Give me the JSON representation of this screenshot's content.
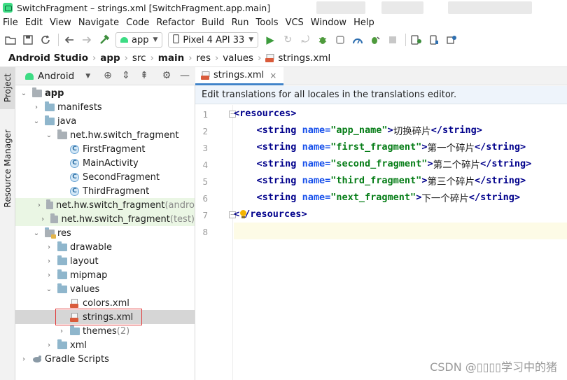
{
  "window": {
    "title": "SwitchFragment – strings.xml [SwitchFragment.app.main]"
  },
  "menu": [
    "File",
    "Edit",
    "View",
    "Navigate",
    "Code",
    "Refactor",
    "Build",
    "Run",
    "Tools",
    "VCS",
    "Window",
    "Help"
  ],
  "toolbar": {
    "module": "app",
    "device": "Pixel 4 API 33"
  },
  "breadcrumb": [
    "Android Studio",
    "app",
    "src",
    "main",
    "res",
    "values",
    "strings.xml"
  ],
  "side_tabs": {
    "project": "Project",
    "resource_manager": "Resource Manager"
  },
  "project_panel": {
    "view": "Android",
    "tree": [
      {
        "label": "app",
        "suffix": "",
        "depth": 0,
        "arrow": "▾",
        "icon": "folder-module",
        "bold": true
      },
      {
        "label": "manifests",
        "suffix": "",
        "depth": 1,
        "arrow": "›",
        "icon": "folder"
      },
      {
        "label": "java",
        "suffix": "",
        "depth": 1,
        "arrow": "▾",
        "icon": "folder"
      },
      {
        "label": "net.hw.switch_fragment",
        "suffix": "",
        "depth": 2,
        "arrow": "▾",
        "icon": "folder-package"
      },
      {
        "label": "FirstFragment",
        "suffix": "",
        "depth": 3,
        "arrow": "",
        "icon": "class"
      },
      {
        "label": "MainActivity",
        "suffix": "",
        "depth": 3,
        "arrow": "",
        "icon": "class"
      },
      {
        "label": "SecondFragment",
        "suffix": "",
        "depth": 3,
        "arrow": "",
        "icon": "class"
      },
      {
        "label": "ThirdFragment",
        "suffix": "",
        "depth": 3,
        "arrow": "",
        "icon": "class"
      },
      {
        "label": "net.hw.switch_fragment",
        "suffix": " (andro",
        "depth": 2,
        "arrow": "›",
        "icon": "folder-package",
        "tinted": true
      },
      {
        "label": "net.hw.switch_fragment",
        "suffix": " (test)",
        "depth": 2,
        "arrow": "›",
        "icon": "folder-package",
        "tinted": true
      },
      {
        "label": "res",
        "suffix": "",
        "depth": 1,
        "arrow": "▾",
        "icon": "folder-res"
      },
      {
        "label": "drawable",
        "suffix": "",
        "depth": 2,
        "arrow": "›",
        "icon": "folder"
      },
      {
        "label": "layout",
        "suffix": "",
        "depth": 2,
        "arrow": "›",
        "icon": "folder"
      },
      {
        "label": "mipmap",
        "suffix": "",
        "depth": 2,
        "arrow": "›",
        "icon": "folder"
      },
      {
        "label": "values",
        "suffix": "",
        "depth": 2,
        "arrow": "▾",
        "icon": "folder"
      },
      {
        "label": "colors.xml",
        "suffix": "",
        "depth": 3,
        "arrow": "",
        "icon": "xml"
      },
      {
        "label": "strings.xml",
        "suffix": "",
        "depth": 3,
        "arrow": "",
        "icon": "xml",
        "selected": true
      },
      {
        "label": "themes",
        "suffix": " (2)",
        "depth": 3,
        "arrow": "›",
        "icon": "folder"
      },
      {
        "label": "xml",
        "suffix": "",
        "depth": 2,
        "arrow": "›",
        "icon": "folder"
      },
      {
        "label": "Gradle Scripts",
        "suffix": "",
        "depth": 0,
        "arrow": "›",
        "icon": "gradle"
      }
    ]
  },
  "editor": {
    "tab": "strings.xml",
    "notice": "Edit translations for all locales in the translations editor.",
    "line_numbers": [
      "1",
      "2",
      "3",
      "4",
      "5",
      "6",
      "7",
      "8"
    ],
    "strings": [
      {
        "name": "app_name",
        "value": "切换碎片"
      },
      {
        "name": "first_fragment",
        "value": "第一个碎片"
      },
      {
        "name": "second_fragment",
        "value": "第二个碎片"
      },
      {
        "name": "third_fragment",
        "value": "第三个碎片"
      },
      {
        "name": "next_fragment",
        "value": "下一个碎片"
      }
    ],
    "root_tag": "resources",
    "child_tag": "string",
    "attr": "name"
  },
  "watermark": "CSDN @▯▯▯▯学习中的猪",
  "colors": {
    "accent": "#4083c9",
    "selection_box": "#e03a3a",
    "tint_row": "#eaf6e4"
  }
}
